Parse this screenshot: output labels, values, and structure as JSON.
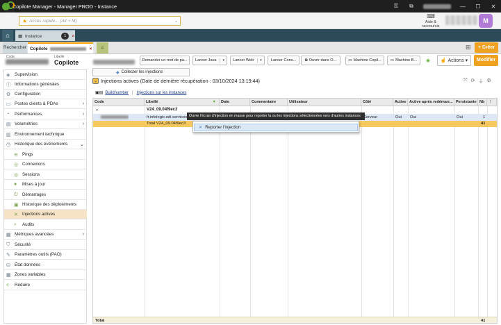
{
  "window": {
    "title": "Copilote Manager - Manager PROD - Instance"
  },
  "toolbar": {
    "menu_label": "Menu",
    "quick_access_placeholder": "Accès rapide... (Alt + M)",
    "help_label_1": "Aide &",
    "help_label_2": "raccourcis",
    "avatar_letter": "M"
  },
  "tabs": {
    "instance_label": "Instance",
    "instance_badge": "1",
    "close_symbol": "×"
  },
  "subtabs": {
    "search_label": "Rechercher",
    "copilote_label": "Copilote",
    "create_label": "Créer"
  },
  "header": {
    "code_label": "Code",
    "libelle_label": "Libellé",
    "libelle_value": "Copilote",
    "actions": [
      "Demander un mot de pa...",
      "Lancer Java",
      "Lancer Web",
      "Lancer Cons...",
      "Ouvrir dans O...",
      "Machine Copil...",
      "Machine B..."
    ],
    "actions_menu_label": "Actions",
    "modify_label": "Modifier"
  },
  "sidebar": {
    "items": [
      {
        "label": "Supervision",
        "icon": "supervision-icon"
      },
      {
        "label": "Informations générales",
        "icon": "info-icon"
      },
      {
        "label": "Configuration",
        "icon": "configuration-icon"
      },
      {
        "label": "Postes clients & PDAs",
        "icon": "monitor-icon"
      },
      {
        "label": "Performances",
        "icon": "gauge-icon"
      },
      {
        "label": "Volumétries",
        "icon": "chart-icon"
      },
      {
        "label": "Environnement technique",
        "icon": "server-icon"
      },
      {
        "label": "Historique des événements",
        "icon": "history-icon"
      },
      {
        "label": "Pings",
        "icon": "wifi-icon"
      },
      {
        "label": "Connexions",
        "icon": "connection-icon"
      },
      {
        "label": "Sessions",
        "icon": "session-icon"
      },
      {
        "label": "Mises à jour",
        "icon": "update-icon"
      },
      {
        "label": "Démarrages",
        "icon": "startup-icon"
      },
      {
        "label": "Historique des déploiements",
        "icon": "deploy-icon"
      },
      {
        "label": "Injections actives",
        "icon": "injection-icon"
      },
      {
        "label": "Audits",
        "icon": "audit-icon"
      },
      {
        "label": "Métriques avancées",
        "icon": "metrics-icon"
      },
      {
        "label": "Sécurité",
        "icon": "security-icon"
      },
      {
        "label": "Paramètres outils (PAO)",
        "icon": "tools-icon"
      },
      {
        "label": "État données",
        "icon": "data-icon"
      },
      {
        "label": "Zones variables",
        "icon": "zones-icon"
      },
      {
        "label": "Réduire",
        "icon": "collapse-icon"
      }
    ]
  },
  "main": {
    "collect_button": "Collecter les injections",
    "section_title": "Injections actives (Date de dernière récupération : 03/10/2024 13:19:44)",
    "group_by": "Buildnumber",
    "injections_link": "Injections sur les instances",
    "columns": [
      "Code",
      "Libellé",
      "Date",
      "Commentaire",
      "Utilisateur",
      "Côté",
      "Active",
      "Active après redémarr...",
      "Persistante",
      "Nb"
    ],
    "group_row": {
      "label": "V24_09.04f9ec3"
    },
    "data_row": {
      "libelle": "fr.infologic.edi.services",
      "cote": "Serveur",
      "active": "Oui",
      "active_apres": "Oui",
      "persistante": "Oui",
      "nb": "1"
    },
    "total_row": {
      "label": "Total V24_09.04f9ec3",
      "nb": "41"
    },
    "footer": {
      "label": "Total",
      "nb": "41"
    },
    "tooltip": "Ouvre l'écran d'injection en masse pour reporter la ou les injections sélectionnées vers d'autres instances",
    "context_menu_item": "Reporter l'injection"
  }
}
